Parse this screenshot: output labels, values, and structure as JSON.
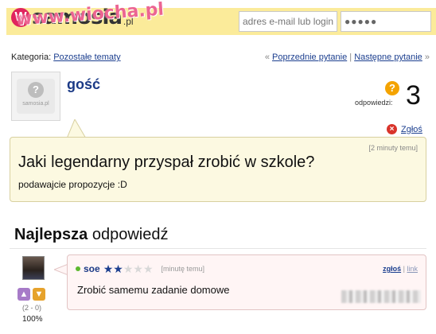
{
  "header": {
    "logo_text": "samosia",
    "logo_suffix": ".pl",
    "logo_badge": "W",
    "watermark": "www.wiocha.pl",
    "email_placeholder": "adres e-mail lub login",
    "password_value": "●●●●●"
  },
  "category": {
    "label": "Kategoria:",
    "value": "Pozostałe tematy",
    "prev_prefix": "«",
    "prev": "Poprzednie pytanie",
    "separator": "|",
    "next": "Następne pytanie",
    "next_suffix": "»"
  },
  "question": {
    "author": "gość",
    "avatar_label": "samosia.pl",
    "answers_label": "odpowiedzi:",
    "answers_count": "3",
    "report": "Zgłoś",
    "time": "[2 minuty temu]",
    "title": "Jaki legendarny przyspał zrobić w szkole?",
    "description": "podawajcie propozycje :D"
  },
  "best_answer": {
    "heading_bold": "Najlepsza",
    "heading_rest": " odpowiedź",
    "user": "soe",
    "rating": 2,
    "rating_max": 5,
    "time": "[minutę temu]",
    "report": "zgłoś",
    "link": "link",
    "link_separator": "|",
    "text": "Zrobić samemu zadanie domowe",
    "votes": "(2 - 0)",
    "percent": "100%"
  },
  "colors": {
    "accent_blue": "#1b3a86",
    "header_yellow": "#fbeb9a",
    "question_bg": "#fcf9e1",
    "answer_bg": "#fff5f5"
  }
}
